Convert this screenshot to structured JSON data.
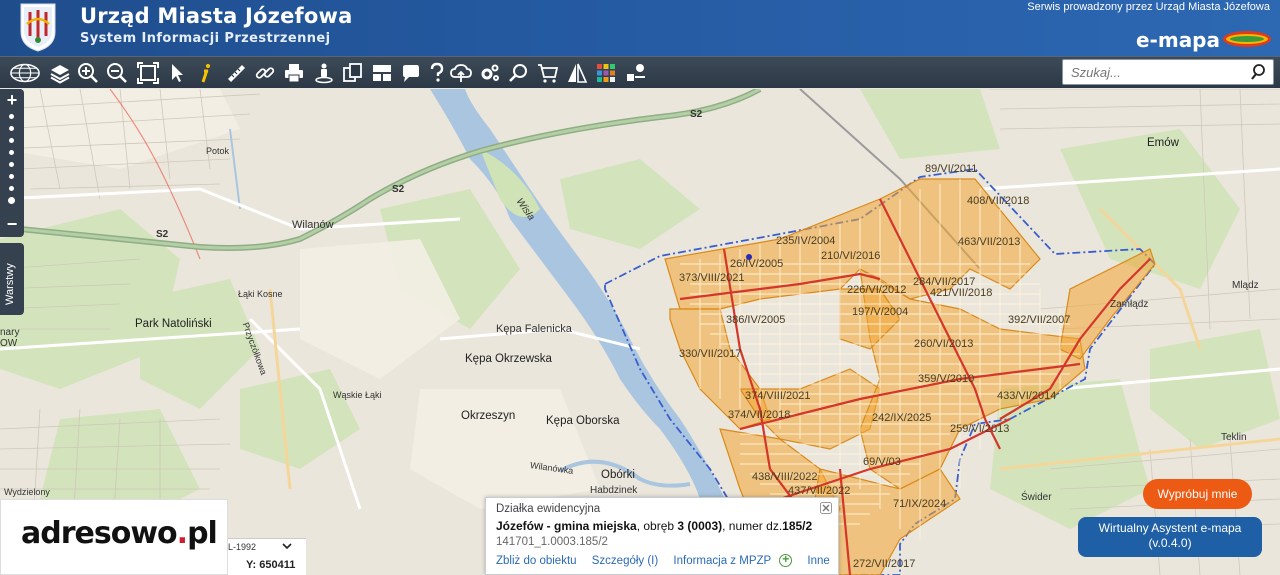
{
  "header": {
    "title": "Urząd Miasta Józefowa",
    "subtitle": "System Informacji Przestrzennej",
    "served_by": "Serwis prowadzony przez Urząd Miasta Józefowa",
    "brand": "e-mapa"
  },
  "toolbar": {
    "tools": [
      "globe-icon",
      "layers-icon",
      "zoom-in-icon",
      "zoom-out-icon",
      "full-extent-icon",
      "pointer-icon",
      "info-icon",
      "ruler-icon",
      "link-icon",
      "print-icon",
      "street-view-icon",
      "copy-icon",
      "layout-icon",
      "comment-icon",
      "help-icon",
      "cloud-upload-icon",
      "settings-icon",
      "search-zoom-icon",
      "cart-icon",
      "compare-icon",
      "color-grid-icon",
      "tools-icon"
    ],
    "search_placeholder": "Szukaj..."
  },
  "map": {
    "places": [
      {
        "name": "Emów"
      },
      {
        "name": "Wilanów"
      },
      {
        "name": "Park Natoliński"
      },
      {
        "name": "Kępa Falenicka"
      },
      {
        "name": "Kępa Okrzewska"
      },
      {
        "name": "Okrzeszyn"
      },
      {
        "name": "Kępa Oborska"
      },
      {
        "name": "Obórki"
      },
      {
        "name": "Habdzinek"
      },
      {
        "name": "Łąki Kosne"
      },
      {
        "name": "Przyczółkowa"
      },
      {
        "name": "Wąskie Łąki"
      },
      {
        "name": "Potok"
      },
      {
        "name": "Wilanówka"
      },
      {
        "name": "Wisła"
      },
      {
        "name": "Zamłądz"
      },
      {
        "name": "Mlądz"
      },
      {
        "name": "Teklin"
      },
      {
        "name": "Świder"
      },
      {
        "name": "Wydzielony"
      },
      {
        "name": "nary"
      },
      {
        "name": "OW"
      }
    ],
    "road_labels": [
      "S2",
      "S2",
      "S2"
    ],
    "plots": [
      "89/VI/2011",
      "408/VII/2018",
      "463/VII/2013",
      "235/IV/2004",
      "210/VI/2016",
      "26/IV/2005",
      "373/VIII/2021",
      "284/VII/2017",
      "421/VII/2018",
      "226/VI/2012",
      "197/V/2004",
      "392/VII/2007",
      "386/IV/2005",
      "260/VI/2013",
      "330/VII/2017",
      "359/V/2010",
      "374/VIII/2021",
      "374/VII/2018",
      "433/VI/2014",
      "242/IX/2025",
      "259/VI/2013",
      "69/V/03",
      "438/VIII/2022",
      "437/VII/2022",
      "71/IX/2024",
      "272/VII/2017"
    ]
  },
  "side": {
    "zoom_in": "+",
    "zoom_out": "−",
    "layers_label": "Warstwy"
  },
  "popup": {
    "type": "Działka ewidencyjna",
    "desc_town": "Józefów - gmina miejska",
    "desc_rest": ", obręb ",
    "desc_obreb": "3 (0003)",
    "desc_num_label": ", numer dz.",
    "desc_num": "185/2",
    "id": "141701_1.0003.185/2",
    "links": [
      "Zbliż do obiektu",
      "Szczegóły (I)",
      "Informacja z MPZP",
      "Inne"
    ]
  },
  "coords": {
    "system": "L-1992",
    "y_label": "Y:",
    "y_value": "650411"
  },
  "adresowo": {
    "logo_main": "adresowo",
    "logo_dot": ".",
    "logo_tld": "pl"
  },
  "assistant": {
    "try_label": "Wypróbuj mnie",
    "name": "Wirtualny Asystent e-mapa",
    "version": "(v.0.4.0)"
  }
}
